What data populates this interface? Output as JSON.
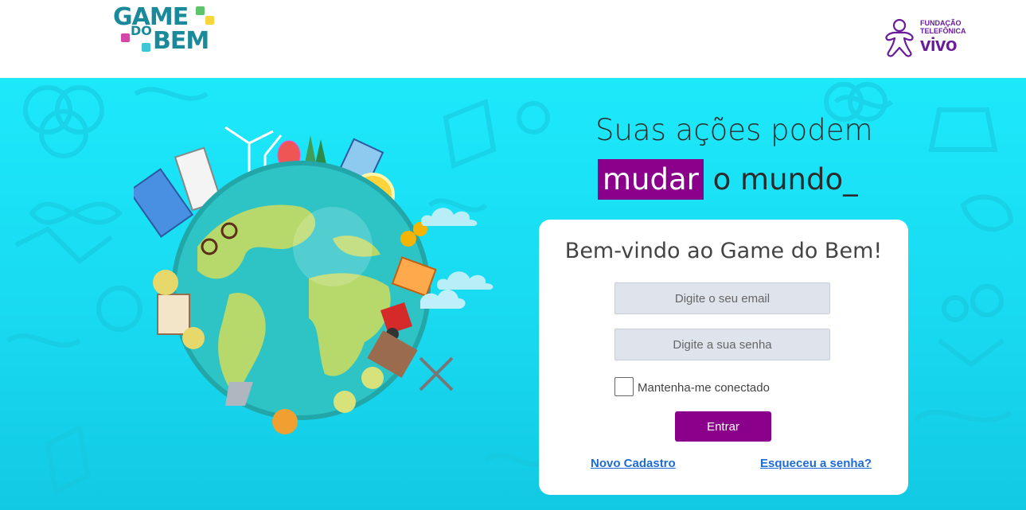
{
  "header": {
    "logo_left": {
      "line1": "GAME",
      "line2": "DO",
      "line3": "BEM"
    },
    "logo_right": {
      "line1": "FUNDAÇÃO",
      "line2": "TELEFÔNICA",
      "line3": "vivo"
    }
  },
  "hero": {
    "headline_line1": "Suas ações podem",
    "headline_highlight": "mudar",
    "headline_rest": " o mundo_"
  },
  "login": {
    "title": "Bem-vindo ao Game do Bem!",
    "email_placeholder": "Digite o seu email",
    "password_placeholder": "Digite a sua senha",
    "remember_label": "Mantenha-me conectado",
    "submit_label": "Entrar",
    "register_link": "Novo Cadastro",
    "forgot_link": "Esqueceu a senha?"
  },
  "colors": {
    "accent": "#8b008b",
    "background": "#1de9fb",
    "link": "#1e6bd6",
    "brand_teal": "#1a8a9a",
    "brand_purple": "#6a1b9a"
  }
}
